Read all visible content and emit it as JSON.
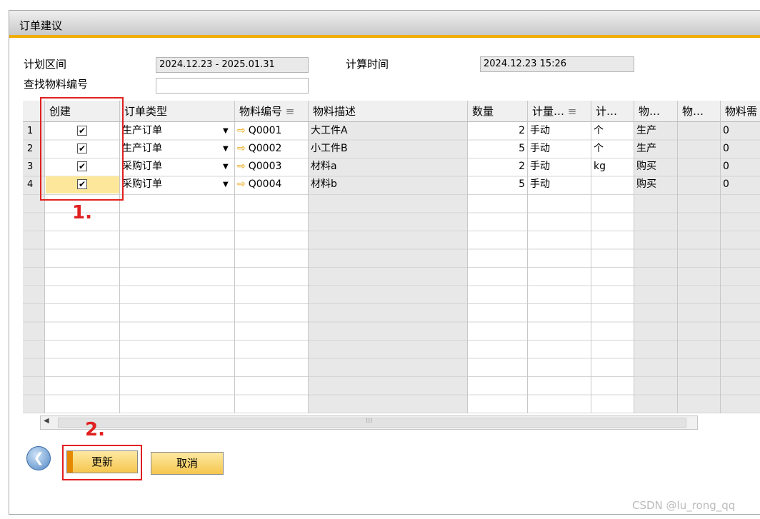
{
  "window": {
    "title": "订单建议"
  },
  "header": {
    "plan_range_label": "计划区间",
    "plan_range_value": "2024.12.23 - 2025.01.31",
    "calc_time_label": "计算时间",
    "calc_time_value": "2024.12.23  15:26",
    "search_label": "查找物料编号",
    "search_value": ""
  },
  "table": {
    "columns": [
      "创建",
      "订单类型",
      "物料编号",
      "物料描述",
      "数量",
      "计量…",
      "计…",
      "物…",
      "物…",
      "物料需"
    ],
    "rows": [
      {
        "num": "1",
        "create": "✔",
        "order_type": "生产订单",
        "item_code": "Q0001",
        "desc": "大工件A",
        "qty": "2",
        "uom_type": "手动",
        "unit": "个",
        "proc": "生产",
        "col9": "",
        "req": "0"
      },
      {
        "num": "2",
        "create": "✔",
        "order_type": "生产订单",
        "item_code": "Q0002",
        "desc": "小工件B",
        "qty": "5",
        "uom_type": "手动",
        "unit": "个",
        "proc": "生产",
        "col9": "",
        "req": "0"
      },
      {
        "num": "3",
        "create": "✔",
        "order_type": "采购订单",
        "item_code": "Q0003",
        "desc": "材料a",
        "qty": "2",
        "uom_type": "手动",
        "unit": "kg",
        "proc": "购买",
        "col9": "",
        "req": "0"
      },
      {
        "num": "4",
        "create": "✔",
        "order_type": "采购订单",
        "item_code": "Q0004",
        "desc": "材料b",
        "qty": "5",
        "uom_type": "手动",
        "unit": "",
        "proc": "购买",
        "col9": "",
        "req": "0"
      }
    ]
  },
  "annotations": {
    "step1": "1.",
    "step2": "2."
  },
  "buttons": {
    "update": "更新",
    "cancel": "取消"
  },
  "watermark": "CSDN @lu_rong_qq",
  "colors": {
    "accent": "#f0ab00",
    "annotation": "#e02020"
  }
}
